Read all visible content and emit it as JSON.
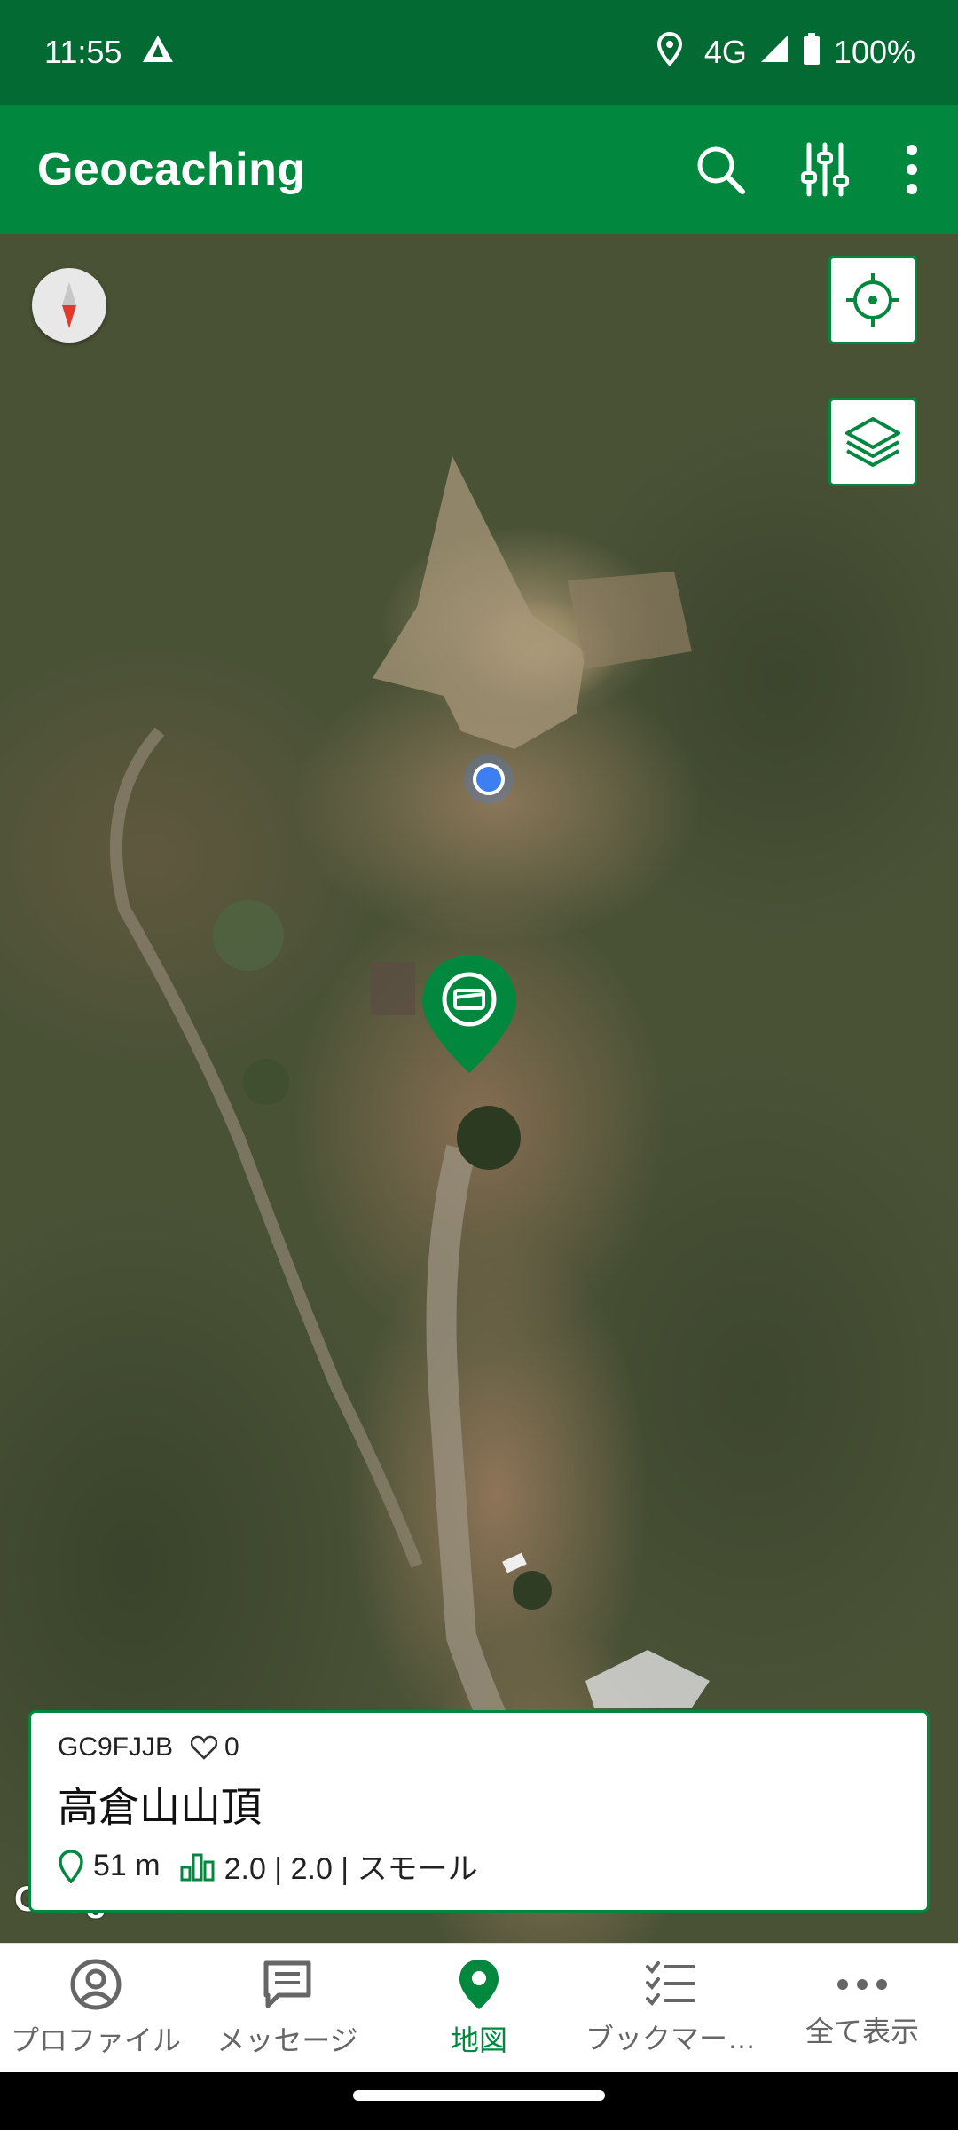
{
  "status_bar": {
    "time": "11:55",
    "network": "4G",
    "battery": "100%",
    "icons": [
      "alert-triangle-icon",
      "location-icon",
      "signal-icon",
      "battery-icon"
    ]
  },
  "app_bar": {
    "title": "Geocaching",
    "actions": [
      "search-icon",
      "filter-sliders-icon",
      "more-vert-icon"
    ]
  },
  "map": {
    "buttons": [
      "compass-icon",
      "my-location-icon",
      "layers-icon"
    ],
    "attribution": "Google"
  },
  "cache_card": {
    "code": "GC9FJJB",
    "favorites": "0",
    "name": "高倉山山頂",
    "distance": "51 m",
    "difficulty_terrain_size": "2.0 | 2.0 | スモール"
  },
  "bottom_nav": {
    "items": [
      {
        "label": "プロファイル",
        "icon": "profile-icon",
        "active": false
      },
      {
        "label": "メッセージ",
        "icon": "message-icon",
        "active": false
      },
      {
        "label": "地図",
        "icon": "map-pin-icon",
        "active": true
      },
      {
        "label": "ブックマー…",
        "icon": "bookmark-list-icon",
        "active": false
      },
      {
        "label": "全て表示",
        "icon": "more-horiz-icon",
        "active": false
      }
    ]
  },
  "colors": {
    "status_bar": "#026a32",
    "app_bar": "#02873e",
    "accent": "#02873e",
    "user_location": "#3d7ff2"
  }
}
